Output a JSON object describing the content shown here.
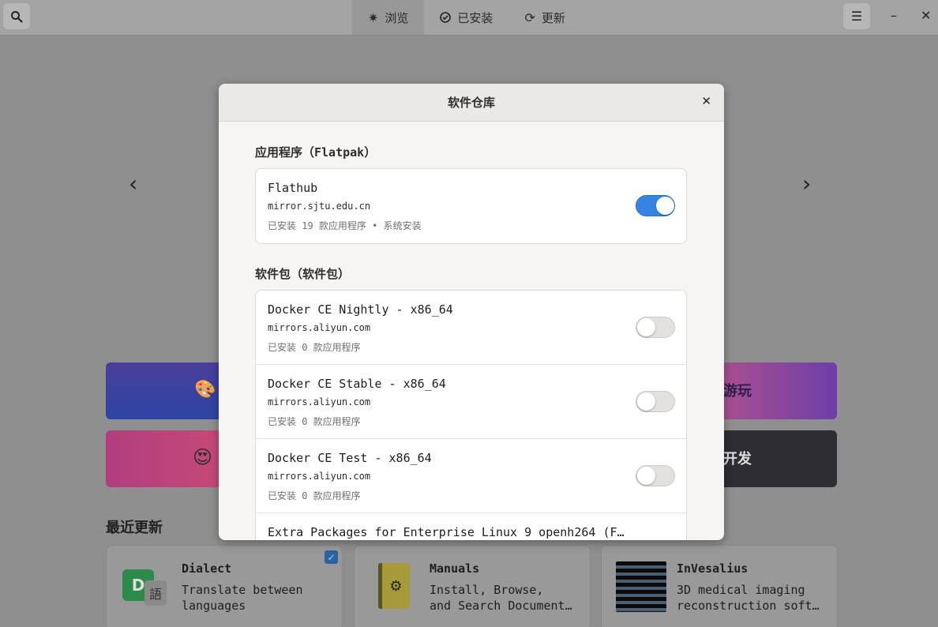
{
  "header": {
    "tabs": [
      {
        "label": "浏览",
        "icon": "compass-icon",
        "active": true
      },
      {
        "label": "已安装",
        "icon": "check-icon",
        "active": false
      },
      {
        "label": "更新",
        "icon": "refresh-icon",
        "active": false
      }
    ]
  },
  "background": {
    "categories": [
      {
        "label": "游玩"
      },
      {
        "label": "开发"
      }
    ],
    "recent_title": "最近更新",
    "apps": [
      {
        "name": "Dialect",
        "desc": "Translate between\nlanguages",
        "checked": true
      },
      {
        "name": "Manuals",
        "desc": "Install, Browse,\nand Search Document…"
      },
      {
        "name": "InVesalius",
        "desc": "3D medical imaging\nreconstruction soft…"
      }
    ]
  },
  "dialog": {
    "title": "软件仓库",
    "groups": [
      {
        "title": "应用程序（Flatpak）",
        "repos": [
          {
            "name": "Flathub",
            "url": "mirror.sjtu.edu.cn",
            "status": "已安装 19 款应用程序 • 系统安装",
            "enabled": true
          }
        ]
      },
      {
        "title": "软件包（软件包）",
        "repos": [
          {
            "name": "Docker CE Nightly - x86_64",
            "url": "mirrors.aliyun.com",
            "status": "已安装 0 款应用程序",
            "enabled": false
          },
          {
            "name": "Docker CE Stable - x86_64",
            "url": "mirrors.aliyun.com",
            "status": "已安装 0 款应用程序",
            "enabled": false
          },
          {
            "name": "Docker CE Test - x86_64",
            "url": "mirrors.aliyun.com",
            "status": "已安装 0 款应用程序",
            "enabled": false
          },
          {
            "name": "Extra Packages for Enterprise Linux 9 openh264 (F…",
            "url": "",
            "status": "",
            "enabled": false
          }
        ]
      }
    ]
  },
  "colors": {
    "accent": "#3584e4",
    "dialog_bg": "#f6f5f4"
  }
}
